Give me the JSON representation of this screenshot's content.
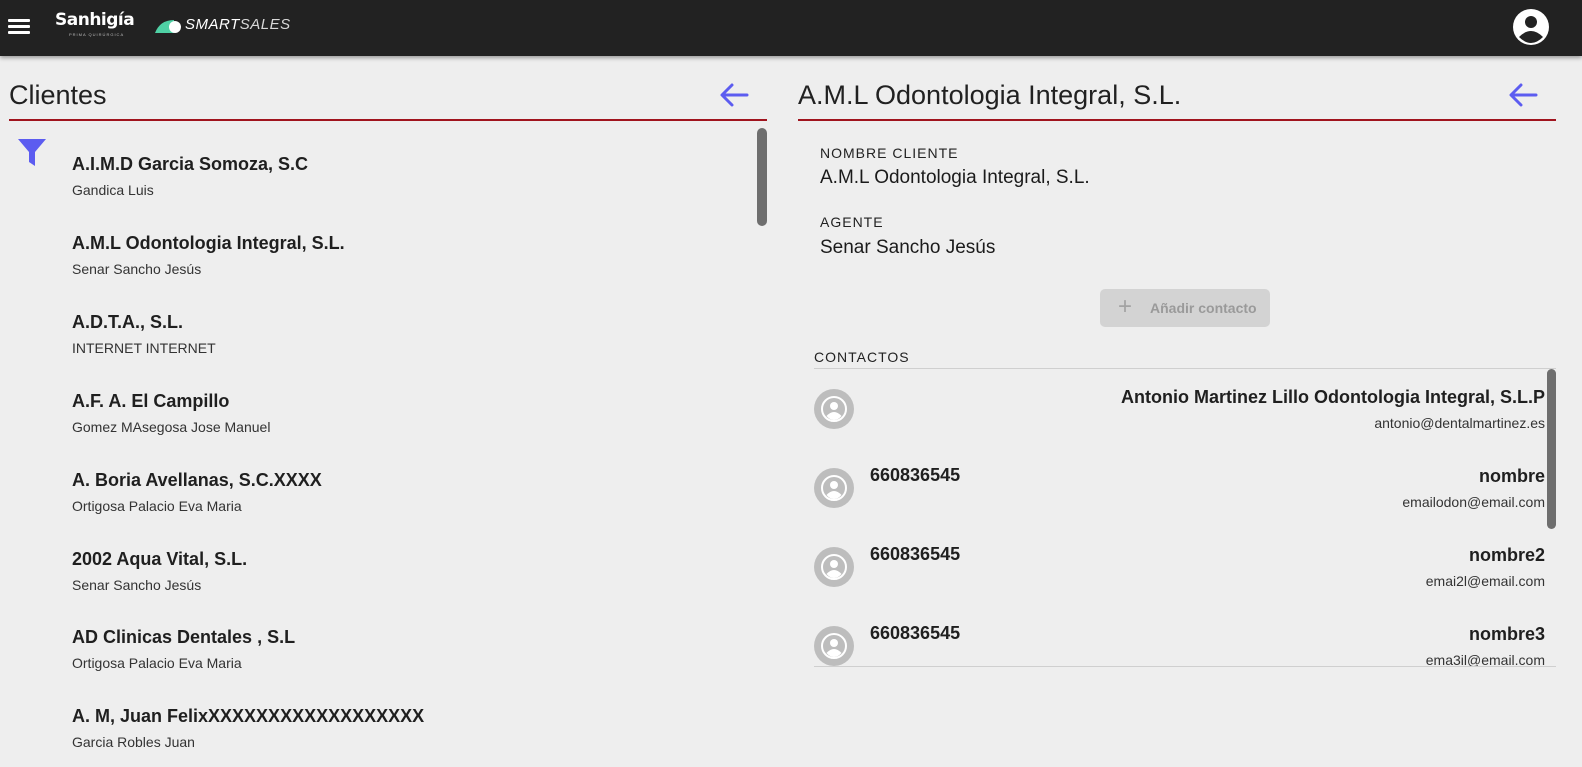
{
  "topbar": {
    "brand": "Sanhigía",
    "brand_tagline": "PRIMA QUIRÚRGICA",
    "product_main": "SMART",
    "product_sub": "SALES",
    "icons": [
      "menu-icon",
      "smartsales-logo-icon",
      "account-circle-icon"
    ]
  },
  "clients_panel": {
    "title": "Clientes",
    "accent_color": "#a0141e",
    "icon_color": "#5c5cf0",
    "items": [
      {
        "name": "A.I.M.D Garcia Somoza, S.C",
        "agent": "Gandica Luis"
      },
      {
        "name": "A.M.L Odontologia Integral, S.L.",
        "agent": "Senar Sancho Jesús"
      },
      {
        "name": "A.D.T.A., S.L.",
        "agent": "INTERNET INTERNET"
      },
      {
        "name": "A.F. A. El Campillo",
        "agent": "Gomez MAsegosa Jose Manuel"
      },
      {
        "name": "A. Boria Avellanas, S.C.XXXX",
        "agent": "Ortigosa Palacio Eva Maria"
      },
      {
        "name": "2002 Aqua Vital, S.L.",
        "agent": "Senar Sancho Jesús"
      },
      {
        "name": "AD Clinicas Dentales , S.L",
        "agent": "Ortigosa Palacio Eva Maria"
      },
      {
        "name": "A. M, Juan FelixXXXXXXXXXXXXXXXXXX",
        "agent": "Garcia Robles Juan"
      }
    ]
  },
  "detail_panel": {
    "title": "A.M.L Odontologia Integral, S.L.",
    "client_label": "NOMBRE CLIENTE",
    "client_value": "A.M.L Odontologia Integral, S.L.",
    "agent_label": "AGENTE",
    "agent_value": "Senar Sancho Jesús",
    "add_contact_label": "Añadir contacto",
    "contacts_label": "CONTACTOS",
    "contacts": [
      {
        "phone": "",
        "name": "Antonio Martinez Lillo Odontologia Integral, S.L.P",
        "email": "antonio@dentalmartinez.es"
      },
      {
        "phone": "660836545",
        "name": "nombre",
        "email": "emailodon@email.com"
      },
      {
        "phone": "660836545",
        "name": "nombre2",
        "email": "emai2l@email.com"
      },
      {
        "phone": "660836545",
        "name": "nombre3",
        "email": "ema3il@email.com"
      }
    ]
  }
}
